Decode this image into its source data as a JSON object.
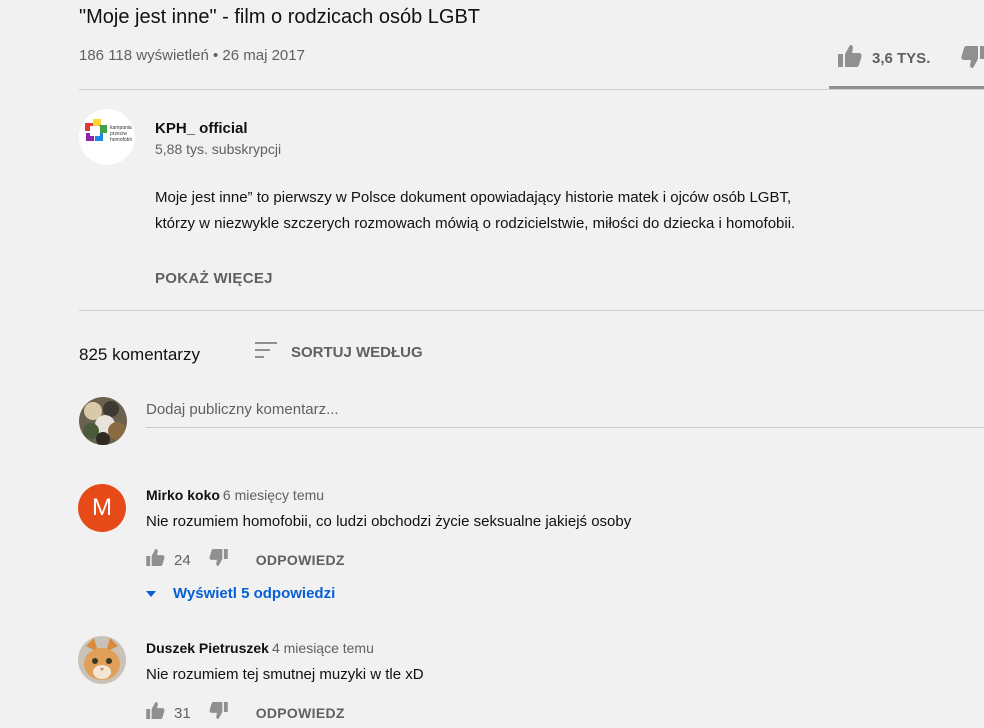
{
  "video": {
    "title": "\"Moje jest inne\" - film o rodzicach osób LGBT",
    "meta": "186 118 wyświetleń • 26 maj 2017",
    "likes": "3,6 TYS."
  },
  "channel": {
    "name": "KPH_ official",
    "subscribers": "5,88 tys. subskrypcji",
    "logo_text": [
      "kampania",
      "przeciw",
      "homofobii"
    ],
    "description_lines": [
      "Moje jest inne” to pierwszy w Polsce dokument opowiadający historie matek i ojców osób LGBT,",
      "którzy w niezwykle szczerych rozmowach mówią o rodzicielstwie, miłości do dziecka i homofobii."
    ],
    "show_more": "POKAŻ WIĘCEJ"
  },
  "comments_section": {
    "count_label": "825 komentarzy",
    "sort_label": "SORTUJ WEDŁUG",
    "add_placeholder": "Dodaj publiczny komentarz..."
  },
  "comments": [
    {
      "avatar_letter": "M",
      "avatar_color": "#e64a19",
      "author": "Mirko koko",
      "time": "6 miesięcy temu",
      "text": "Nie rozumiem homofobii, co ludzi obchodzi życie seksualne jakiejś osoby",
      "likes": "24",
      "reply": "ODPOWIEDZ",
      "view_replies": "Wyświetl 5 odpowiedzi"
    },
    {
      "author": "Duszek Pietruszek",
      "time": "4 miesiące temu",
      "text": "Nie rozumiem tej smutnej muzyki w tle xD",
      "likes": "31",
      "reply": "ODPOWIEDZ"
    }
  ],
  "colors": {
    "background": "#f1f1f1",
    "link_blue": "#065fd4",
    "icon_gray": "#909090",
    "text_secondary": "#606060"
  },
  "icons": [
    "thumb-up-icon",
    "thumb-down-icon",
    "sort-icon",
    "caret-down-icon"
  ]
}
